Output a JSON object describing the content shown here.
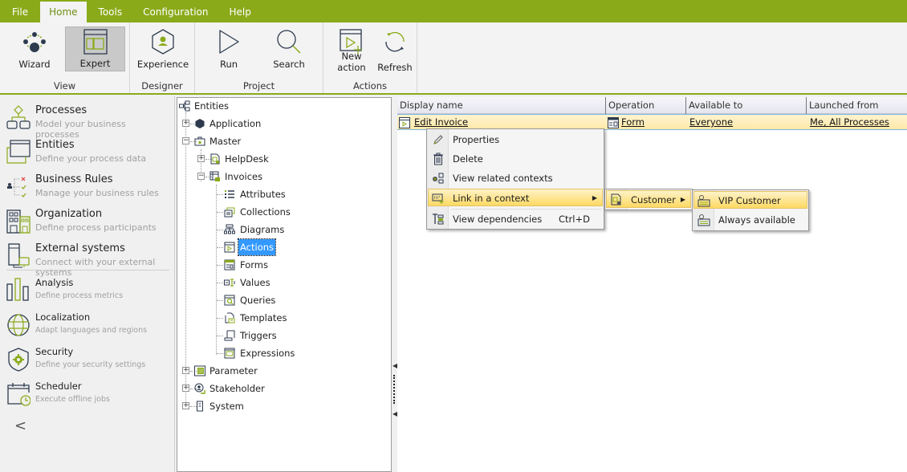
{
  "menubar": {
    "tabs": [
      "File",
      "Home",
      "Tools",
      "Configuration",
      "Help"
    ],
    "active": "Home",
    "colors": {
      "brand": "#8aaa1a",
      "accent_dark": "#2d3a4e",
      "accent_green": "#8aaa1a"
    }
  },
  "ribbon": {
    "groups": [
      {
        "label": "View",
        "buttons": [
          {
            "label": "Wizard",
            "icon": "wizard-icon"
          },
          {
            "label": "Expert",
            "icon": "expert-icon",
            "selected": true
          }
        ]
      },
      {
        "label": "Designer",
        "buttons": [
          {
            "label": "Experience",
            "icon": "experience-icon"
          }
        ]
      },
      {
        "label": "Project",
        "buttons": [
          {
            "label": "Run",
            "icon": "run-icon"
          },
          {
            "label": "Search",
            "icon": "search-icon"
          }
        ]
      },
      {
        "label": "Actions",
        "buttons": [
          {
            "label": "New action",
            "icon": "new-action-icon"
          },
          {
            "label": "Refresh",
            "icon": "refresh-icon"
          }
        ]
      }
    ]
  },
  "sidebar": {
    "items": [
      {
        "title": "Processes",
        "desc": "Model your business processes",
        "icon": "processes-icon"
      },
      {
        "title": "Entities",
        "desc": "Define your process data",
        "icon": "entities-icon"
      },
      {
        "title": "Business Rules",
        "desc": "Manage your business rules",
        "icon": "business-rules-icon"
      },
      {
        "title": "Organization",
        "desc": "Define process participants",
        "icon": "organization-icon"
      },
      {
        "title": "External systems",
        "desc": "Connect with your external systems",
        "icon": "external-systems-icon"
      },
      {
        "title": "Analysis",
        "desc": "Define process metrics",
        "icon": "analysis-icon"
      },
      {
        "title": "Localization",
        "desc": "Adapt languages and regions",
        "icon": "localization-icon"
      },
      {
        "title": "Security",
        "desc": "Define your security settings",
        "icon": "security-icon"
      },
      {
        "title": "Scheduler",
        "desc": "Execute offline jobs",
        "icon": "scheduler-icon"
      }
    ],
    "collapse_glyph": "<"
  },
  "tree": {
    "root": "Entities",
    "nodes": [
      {
        "label": "Application",
        "expander": "+"
      },
      {
        "label": "Master",
        "expander": "−"
      },
      {
        "label": "HelpDesk",
        "expander": "+"
      },
      {
        "label": "Invoices",
        "expander": "−"
      },
      {
        "label": "Attributes"
      },
      {
        "label": "Collections"
      },
      {
        "label": "Diagrams"
      },
      {
        "label": "Actions",
        "selected": true
      },
      {
        "label": "Forms"
      },
      {
        "label": "Values"
      },
      {
        "label": "Queries"
      },
      {
        "label": "Templates"
      },
      {
        "label": "Triggers"
      },
      {
        "label": "Expressions"
      },
      {
        "label": "Parameter",
        "expander": "+"
      },
      {
        "label": "Stakeholder",
        "expander": "+"
      },
      {
        "label": "System",
        "expander": "+"
      }
    ]
  },
  "grid": {
    "columns": [
      "Display name",
      "Operation",
      "Available to",
      "Launched from"
    ],
    "rows": [
      {
        "display_name": "Edit Invoice",
        "operation": "Form",
        "available_to": "Everyone",
        "launched_from": "Me, All Processes"
      }
    ]
  },
  "context_menu": {
    "items": [
      {
        "label": "Properties",
        "icon": "pencil-icon"
      },
      {
        "label": "Delete",
        "icon": "trash-icon"
      },
      {
        "label": "View related contexts",
        "icon": "related-contexts-icon"
      },
      {
        "label": "Link in a context",
        "icon": "link-context-icon",
        "submenu": true,
        "highlighted": true
      },
      {
        "label": "View dependencies",
        "icon": "dependencies-icon",
        "shortcut": "Ctrl+D"
      }
    ],
    "submenu": {
      "items": [
        {
          "label": "Customer",
          "icon": "entity-icon",
          "submenu": true,
          "highlighted": true
        }
      ]
    },
    "submenu2": {
      "items": [
        {
          "label": "VIP Customer",
          "icon": "context-icon",
          "highlighted": true
        },
        {
          "label": "Always available",
          "icon": "context-icon"
        }
      ]
    },
    "submenu_arrow": "▶"
  }
}
